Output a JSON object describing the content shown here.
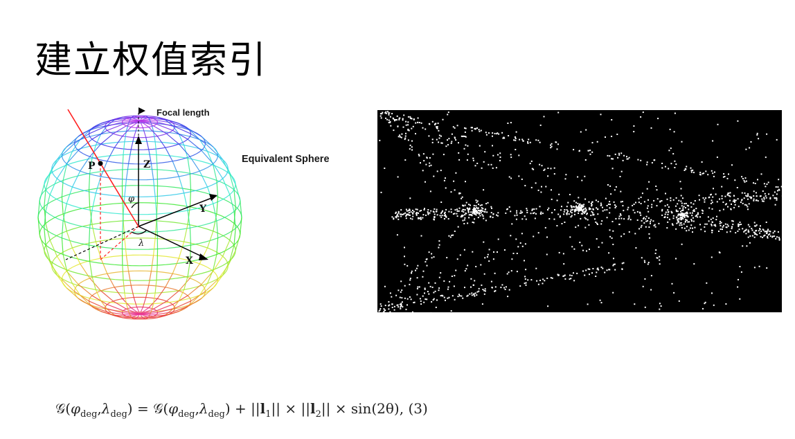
{
  "slide": {
    "title": "建立权值索引"
  },
  "sphere_figure": {
    "focal_label": "Focal length",
    "equivalent_label": "Equivalent Sphere",
    "point_label": "P",
    "z_label": "Z",
    "y_label": "Y",
    "x_label": "X",
    "phi_label": "φ",
    "lambda_label": "λ",
    "colors": {
      "ray": "#ff2020",
      "axis": "#000000"
    }
  },
  "dots_figure": {
    "background": "#000000",
    "dot_color": "#ffffff",
    "cluster_count": 3
  },
  "formula": {
    "G": "𝒢(",
    "phi": "φ",
    "deg": "deg",
    "lambda": "λ",
    "close": ")",
    "eq": " = ",
    "plus": " + ||",
    "l1": "l",
    "one": "1",
    "times1": "|| × ||",
    "two": "2",
    "times2": "|| × sin(2θ),  (3)"
  }
}
